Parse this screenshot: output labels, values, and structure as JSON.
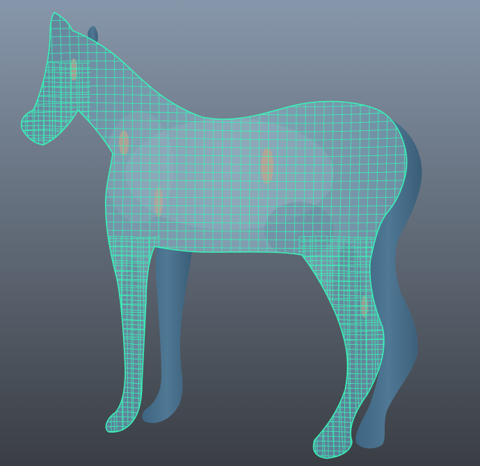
{
  "viewport": {
    "background_top": "#8797ab",
    "background_bottom": "#3a3e44"
  },
  "model": {
    "solid_color": "#4e7591",
    "shaded_color": "#7493a6",
    "wire_color": "#39f3b8",
    "skin_patch_color": "#c3a38c"
  }
}
